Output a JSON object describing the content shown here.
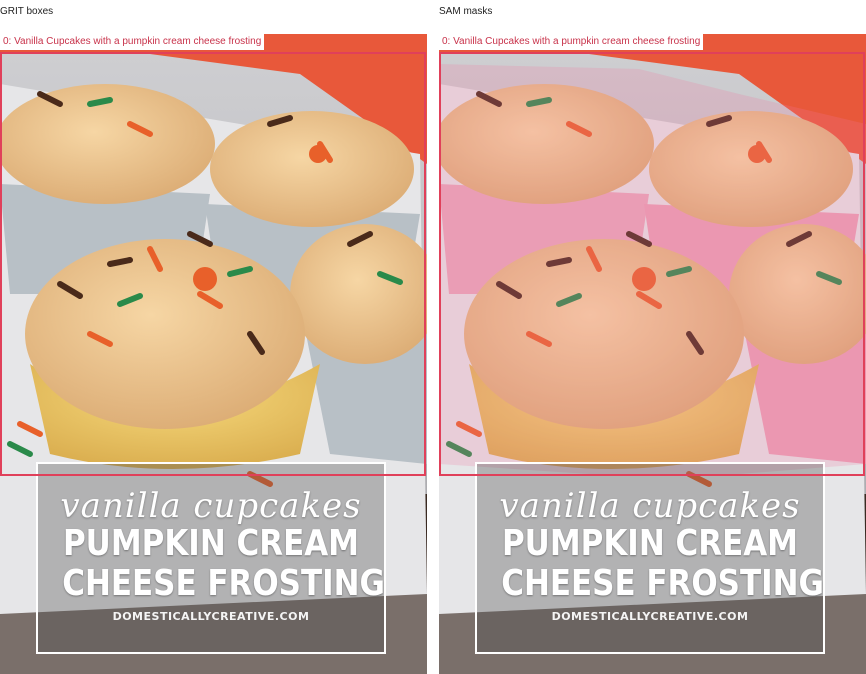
{
  "panels": [
    {
      "title": "GRIT boxes",
      "detection_label": "0: Vanilla Cupcakes with a pumpkin cream cheese frosting",
      "show_mask": false
    },
    {
      "title": "SAM masks",
      "detection_label": "0: Vanilla Cupcakes with a pumpkin cream cheese frosting",
      "show_mask": true
    }
  ],
  "photo_text": {
    "script": "vanilla cupcakes",
    "line1": "PUMPKIN CREAM",
    "line2": "CHEESE FROSTING",
    "site": "DOMESTICALLYCREATIVE.COM"
  },
  "colors": {
    "box": "#e0405a",
    "label_text": "#c8324a",
    "mask": "#f0a0b4",
    "frosting": "#eec58f",
    "cake": "#f0cf6a",
    "placemat": "#e8583a"
  }
}
